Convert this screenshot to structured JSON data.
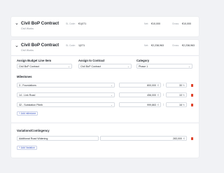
{
  "contracts": [
    {
      "title": "Civil BoP Contract",
      "subtitle": "Civil Works",
      "sl_label": "SL Code:",
      "sl_value": "€1(071",
      "net_label": "Net:",
      "net_value": "€10,000",
      "gross_label": "Gross:",
      "gross_value": "€10,000"
    },
    {
      "title": "Civil BoP Contract",
      "subtitle": "Civil Works",
      "sl_label": "SL Code:",
      "sl_value": "1(071",
      "net_label": "Net:",
      "net_value": "€2,238,963",
      "gross_label": "Gross:",
      "gross_value": "€2,238,963"
    }
  ],
  "assign": {
    "budget_label": "Assign Budget Line Item",
    "budget_value": "Civil BoP Contract",
    "contract_label": "Assign to Contract",
    "contract_value": "Civil BoP Contract",
    "category_label": "Category",
    "category_value": "Phase 1"
  },
  "milestones": {
    "heading": "Milestones",
    "rows": [
      {
        "name": "3 - Foundations",
        "amount": "800,000",
        "currency": "€",
        "percent": "30",
        "pct_unit": "%"
      },
      {
        "name": "14 - Link Road",
        "amount": "456,000",
        "currency": "€",
        "percent": "10",
        "pct_unit": "%"
      },
      {
        "name": "32 - Substation Plinth",
        "amount": "999,863",
        "currency": "€",
        "percent": "16",
        "pct_unit": "%"
      }
    ],
    "add_label": "+ Add milestone"
  },
  "variations": {
    "heading": "Variations/Contingency",
    "row": {
      "name": "Additional Road Widening",
      "amount": "283,000",
      "currency": "€"
    },
    "add_label": "+ Add Variation"
  },
  "colors": {
    "accent": "#3b57c4",
    "danger": "#e0452d"
  }
}
